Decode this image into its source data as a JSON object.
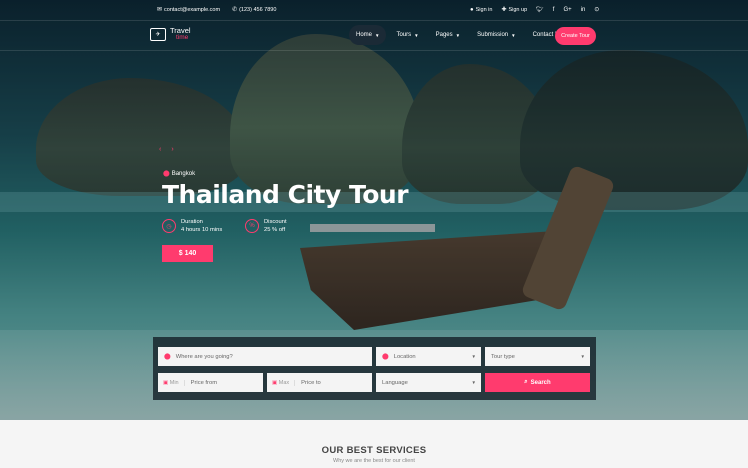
{
  "topbar": {
    "email": "contact@example.com",
    "phone": "(123) 456 7890",
    "sign_in": "Sign in",
    "sign_up": "Sign up",
    "social_icons": [
      "twitter-icon",
      "facebook-icon",
      "google-plus-icon",
      "linkedin-icon",
      "pinterest-icon"
    ]
  },
  "logo": {
    "line1": "Travel",
    "line2": "time"
  },
  "nav": {
    "items": [
      "Home",
      "Tours",
      "Pages",
      "Submission",
      "Contact Us"
    ],
    "active": "Home",
    "cta": "Create Tour"
  },
  "hero": {
    "location": "Bangkok",
    "title": "Thailand City Tour",
    "duration_label": "Duration",
    "duration_value": "4 hours 10 mins",
    "discount_label": "Discount",
    "discount_value": "25 % off",
    "price": "$ 140"
  },
  "search": {
    "destination_placeholder": "Where are you going?",
    "location_value": "Location",
    "tour_type_value": "Tour type",
    "min_tag": "Min",
    "price_from_placeholder": "Price from",
    "max_tag": "Max",
    "price_to_placeholder": "Price to",
    "language_value": "Language",
    "button": "Search"
  },
  "services": {
    "title": "OUR BEST SERVICES",
    "subtitle": "Why we are the best for our client"
  },
  "colors": {
    "accent": "#ff3b6e",
    "panel": "#19262d"
  }
}
